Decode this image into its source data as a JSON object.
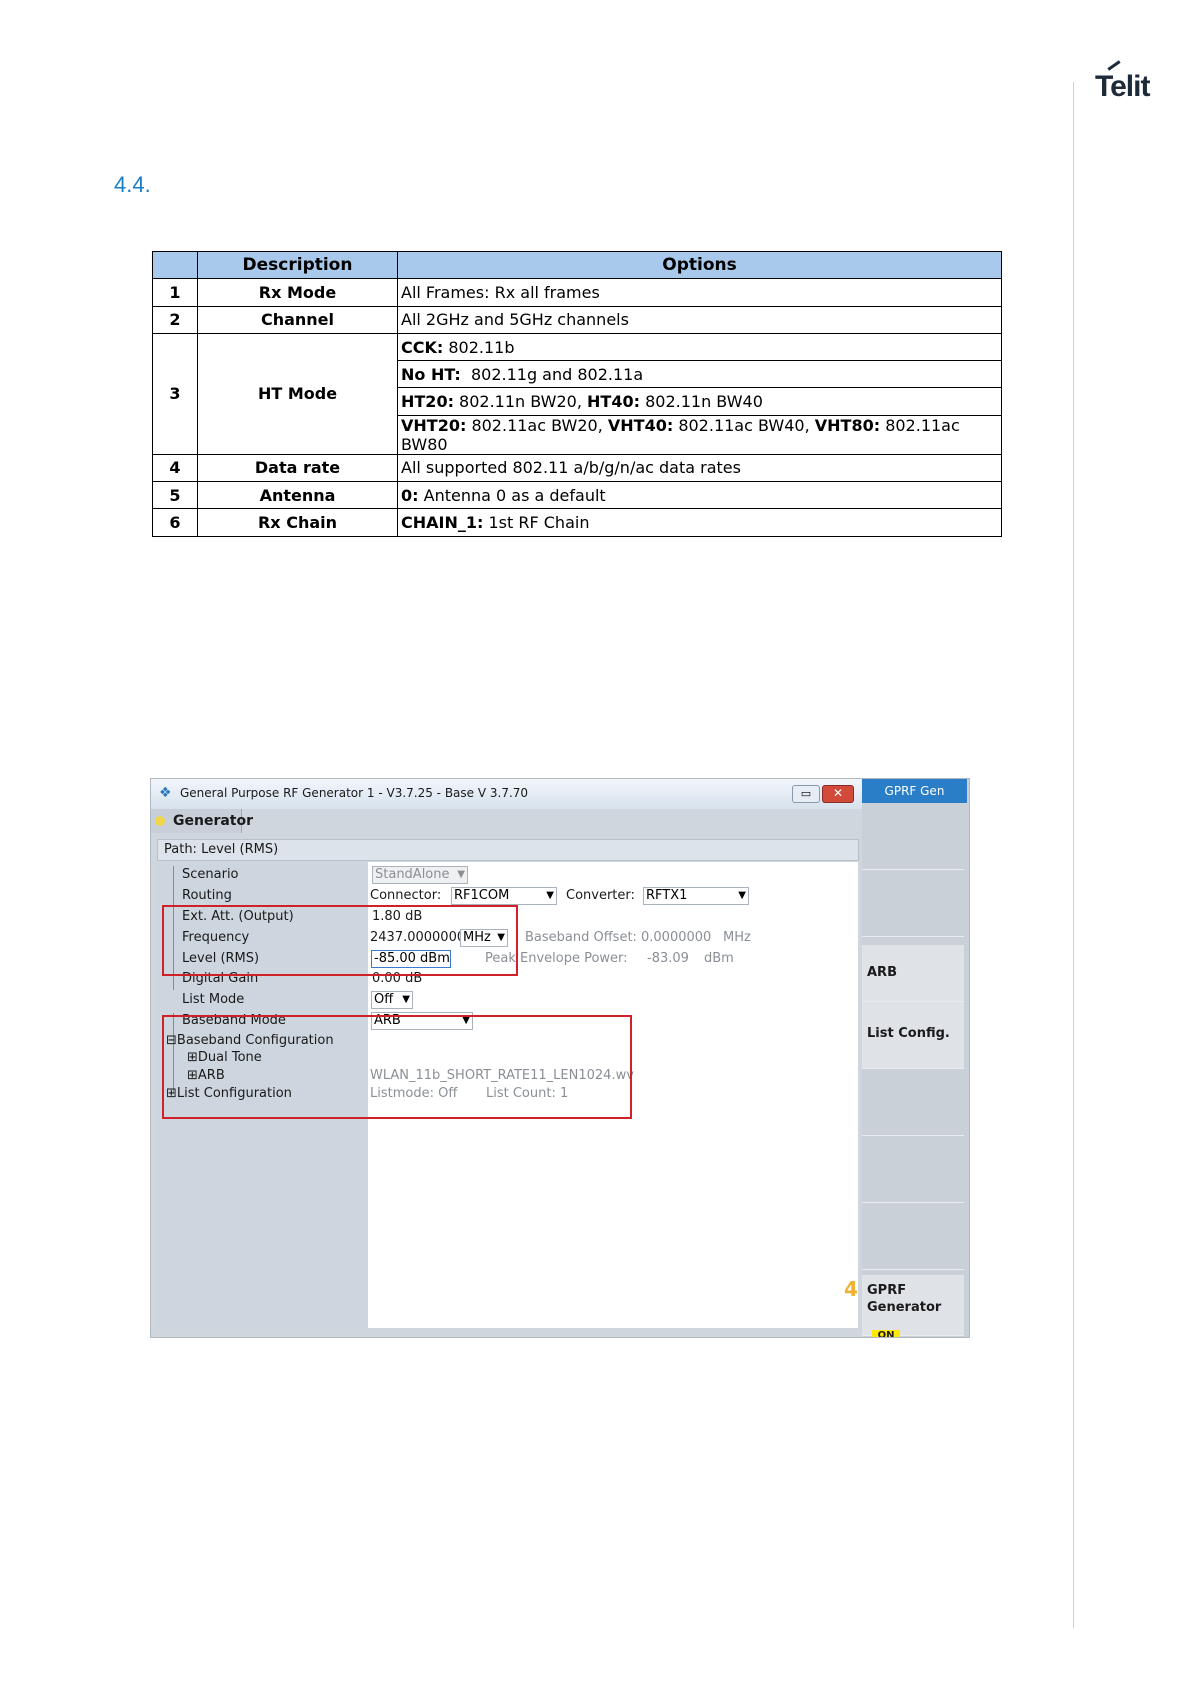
{
  "header": {
    "logo": "Telit",
    "section_number": "4.4."
  },
  "table": {
    "headers": [
      "Description",
      "Options"
    ],
    "rows": [
      {
        "num": "1",
        "desc": "Rx Mode",
        "opt_b": "",
        "opt": "All Frames: Rx all frames"
      },
      {
        "num": "2",
        "desc": "Channel",
        "opt_b": "",
        "opt": "All 2GHz and 5GHz channels"
      },
      {
        "num": "3",
        "desc": "HT Mode",
        "opt_b": "CCK:",
        "opt": " 802.11b"
      },
      {
        "opt_b": "No HT:",
        "opt": "  802.11g and 802.11a"
      },
      {
        "opt_b": "HT20:",
        "opt": " 802.11n BW20, ",
        "opt_b2": "HT40:",
        "opt2": " 802.11n BW40"
      },
      {
        "opt_b": "VHT20:",
        "opt": " 802.11ac BW20, ",
        "opt_b2": "VHT40:",
        "opt2": " 802.11ac BW40, ",
        "opt_b3": "VHT80:",
        "opt3": " 802.11ac BW80"
      },
      {
        "num": "4",
        "desc": "Data rate",
        "opt_b": "",
        "opt": "All supported 802.11 a/b/g/n/ac data rates"
      },
      {
        "num": "5",
        "desc": "Antenna",
        "opt_b": "0:",
        "opt": " Antenna 0 as a default"
      },
      {
        "num": "6",
        "desc": "Rx Chain",
        "opt_b": "CHAIN_1:",
        "opt": " 1st RF Chain"
      }
    ]
  },
  "app": {
    "title": "General Purpose RF Generator 1 - V3.7.25 - Base V 3.7.70",
    "minimize_icon": "minimize-icon",
    "close_icon": "close-icon",
    "tab_label": "Generator",
    "path_label": "Path:",
    "path_value": "Level (RMS)",
    "tree": {
      "scenario": "Scenario",
      "routing": "Routing",
      "ext_att": "Ext. Att. (Output)",
      "frequency": "Frequency",
      "level": "Level (RMS)",
      "digital_gain": "Digital Gain",
      "list_mode": "List Mode",
      "baseband_mode": "Baseband Mode",
      "baseband_config": "Baseband Configuration",
      "dual_tone": "Dual Tone",
      "arb": "ARB",
      "list_config": "List Configuration"
    },
    "values": {
      "scenario": "StandAlone",
      "connector_label": "Connector:",
      "connector": "RF1COM",
      "converter_label": "Converter:",
      "converter": "RFTX1",
      "ext_att": "1.80 dB",
      "frequency": "2437.0000000",
      "frequency_unit": "MHz",
      "baseband_offset_label": "Baseband Offset:",
      "baseband_offset": "0.0000000",
      "baseband_offset_unit": "MHz",
      "level": "-85.00 dBm",
      "pep_label": "Peak Envelope Power:",
      "pep": "-83.09",
      "pep_unit": "dBm",
      "digital_gain": "0.00 dB",
      "list_mode": "Off",
      "baseband_mode": "ARB",
      "arb_file": "WLAN_11b_SHORT_RATE11_LEN1024.wv",
      "listmode_status": "Listmode: Off",
      "list_count": "List Count:  1"
    },
    "annotations": {
      "box_4": "4"
    },
    "softkeys": {
      "top": "GPRF Gen",
      "arb": "ARB",
      "list_config": "List Config.",
      "gprf_line1": "GPRF",
      "gprf_line2": "Generator",
      "gprf_state": "ON"
    },
    "colors": {
      "accent_blue": "#2a7ec8",
      "highlight_red": "#d0202a",
      "on_yellow": "#ffe800",
      "table_header": "#a9c9ec"
    }
  }
}
